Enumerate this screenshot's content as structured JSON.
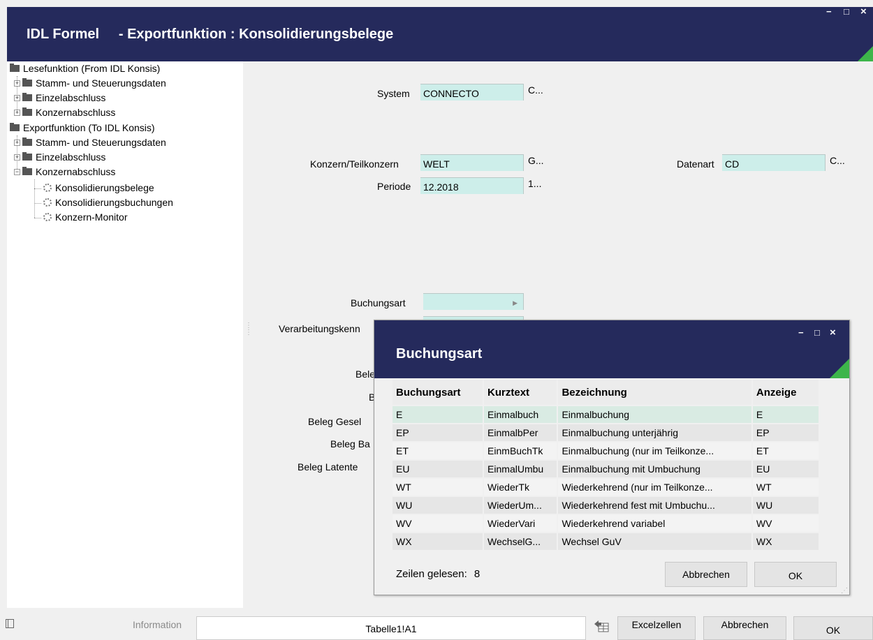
{
  "app": {
    "title": "IDL Formel     - Exportfunktion : Konsolidierungsbelege",
    "minimize": "−",
    "maximize": "□",
    "close": "×"
  },
  "tree": {
    "items": [
      {
        "label": "Lesefunktion (From IDL Konsis)"
      },
      {
        "label": "Stamm- und Steuerungsdaten"
      },
      {
        "label": "Einzelabschluss"
      },
      {
        "label": "Konzernabschluss"
      },
      {
        "label": "Exportfunktion (To IDL Konsis)"
      },
      {
        "label": "Stamm- und Steuerungsdaten"
      },
      {
        "label": "Einzelabschluss"
      },
      {
        "label": "Konzernabschluss"
      },
      {
        "label": "Konsolidierungsbelege"
      },
      {
        "label": "Konsolidierungsbuchungen"
      },
      {
        "label": "Konzern-Monitor"
      }
    ]
  },
  "form": {
    "system_label": "System",
    "system_value": "CONNECTO",
    "system_suffix": "C...",
    "konzern_label": "Konzern/Teilkonzern",
    "konzern_value": "WELT",
    "konzern_suffix": "G...",
    "datenart_label": "Datenart",
    "datenart_value": "CD",
    "datenart_suffix": "C...",
    "periode_label": "Periode",
    "periode_value": "12.2018",
    "periode_suffix": "1...",
    "buchungsart_label": "Buchungsart",
    "buchungsart_value": "",
    "verarbeitung_label": "Verarbeitungskenn",
    "beleg1_label": "Beleg",
    "beleg2_label": "B",
    "beleg_gesel_label": "Beleg Gesel",
    "beleg_ba_label": "Beleg Ba",
    "beleg_latente_label": "Beleg Latente"
  },
  "dialog": {
    "title": "Buchungsart",
    "columns": [
      "Buchungsart",
      "Kurztext",
      "Bezeichnung",
      "Anzeige"
    ],
    "rows": [
      [
        "E",
        "Einmalbuch",
        "Einmalbuchung",
        "E"
      ],
      [
        "EP",
        "EinmalbPer",
        "Einmalbuchung unterjährig",
        "EP"
      ],
      [
        "ET",
        "EinmBuchTk",
        "Einmalbuchung (nur im Teilkonze...",
        "ET"
      ],
      [
        "EU",
        "EinmalUmbu",
        "Einmalbuchung mit Umbuchung",
        "EU"
      ],
      [
        "WT",
        "WiederTk",
        "Wiederkehrend (nur im Teilkonze...",
        "WT"
      ],
      [
        "WU",
        "WiederUm...",
        "Wiederkehrend fest mit Umbuchu...",
        "WU"
      ],
      [
        "WV",
        "WiederVari",
        "Wiederkehrend variabel",
        "WV"
      ],
      [
        "WX",
        "WechselG...",
        "Wechsel GuV",
        "WX"
      ]
    ],
    "rows_label": "Zeilen gelesen:",
    "rows_count": "8",
    "cancel_label": "Abbrechen",
    "ok_label": "OK"
  },
  "footer": {
    "information_label": "Information",
    "cell_ref": "Tabelle1!A1",
    "excel_label": "Excelzellen",
    "cancel_label": "Abbrechen",
    "ok_label": "OK"
  },
  "colors": {
    "titlebar": "#252a5c",
    "accent_green": "#3db54a",
    "field_bg": "#cdeeea"
  }
}
